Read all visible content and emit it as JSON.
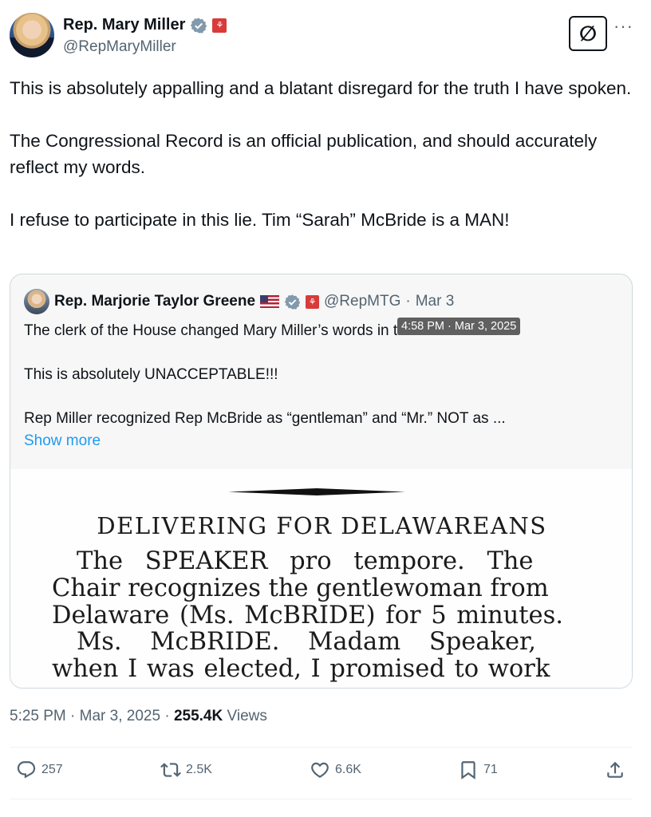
{
  "author": {
    "display_name": "Rep. Mary Miller",
    "handle": "@RepMaryMiller"
  },
  "grok_button_label": "∅",
  "more_label": "···",
  "tweet": {
    "paragraphs": [
      "This is absolutely appalling and a blatant disregard for the truth I have spoken.",
      "The Congressional Record is an official publication, and should accurately reflect my words.",
      "I refuse to participate in this lie. Tim “Sarah” McBride is a MAN!"
    ]
  },
  "quote": {
    "display_name": "Rep. Marjorie Taylor Greene",
    "handle": "@RepMTG",
    "separator": "·",
    "date": "Mar 3",
    "tooltip": "4:58 PM · Mar 3, 2025",
    "paragraphs": [
      "The clerk of the House changed Mary Miller’s words in the record.",
      "This is absolutely UNACCEPTABLE!!!",
      "Rep Miller recognized Rep McBride as “gentleman” and “Mr.” NOT as ..."
    ],
    "show_more": "Show more",
    "media": {
      "heading": "DELIVERING FOR DELAWAREANS",
      "lines": [
        "The SPEAKER pro tempore. The",
        "Chair recognizes the gentlewoman from",
        "Delaware (Ms. McBRIDE) for 5 minutes.",
        "Ms. McBRIDE. Madam Speaker,",
        "when I was elected, I promised to work"
      ]
    }
  },
  "meta": {
    "time": "5:25 PM",
    "date": "Mar 3, 2025",
    "separator": "·",
    "views_count": "255.4K",
    "views_label": "Views"
  },
  "actions": {
    "replies": "257",
    "reposts": "2.5K",
    "likes": "6.6K",
    "bookmarks": "71"
  },
  "colors": {
    "text": "#0f1419",
    "secondary": "#536471",
    "link": "#1d9bf0",
    "verified_badge": "#829aab",
    "affiliation_badge": "#d93a3a"
  },
  "icons": [
    "verified-badge-icon",
    "congress-affiliation-icon",
    "us-flag-icon",
    "reply-icon",
    "repost-icon",
    "like-icon",
    "bookmark-icon",
    "share-icon"
  ]
}
